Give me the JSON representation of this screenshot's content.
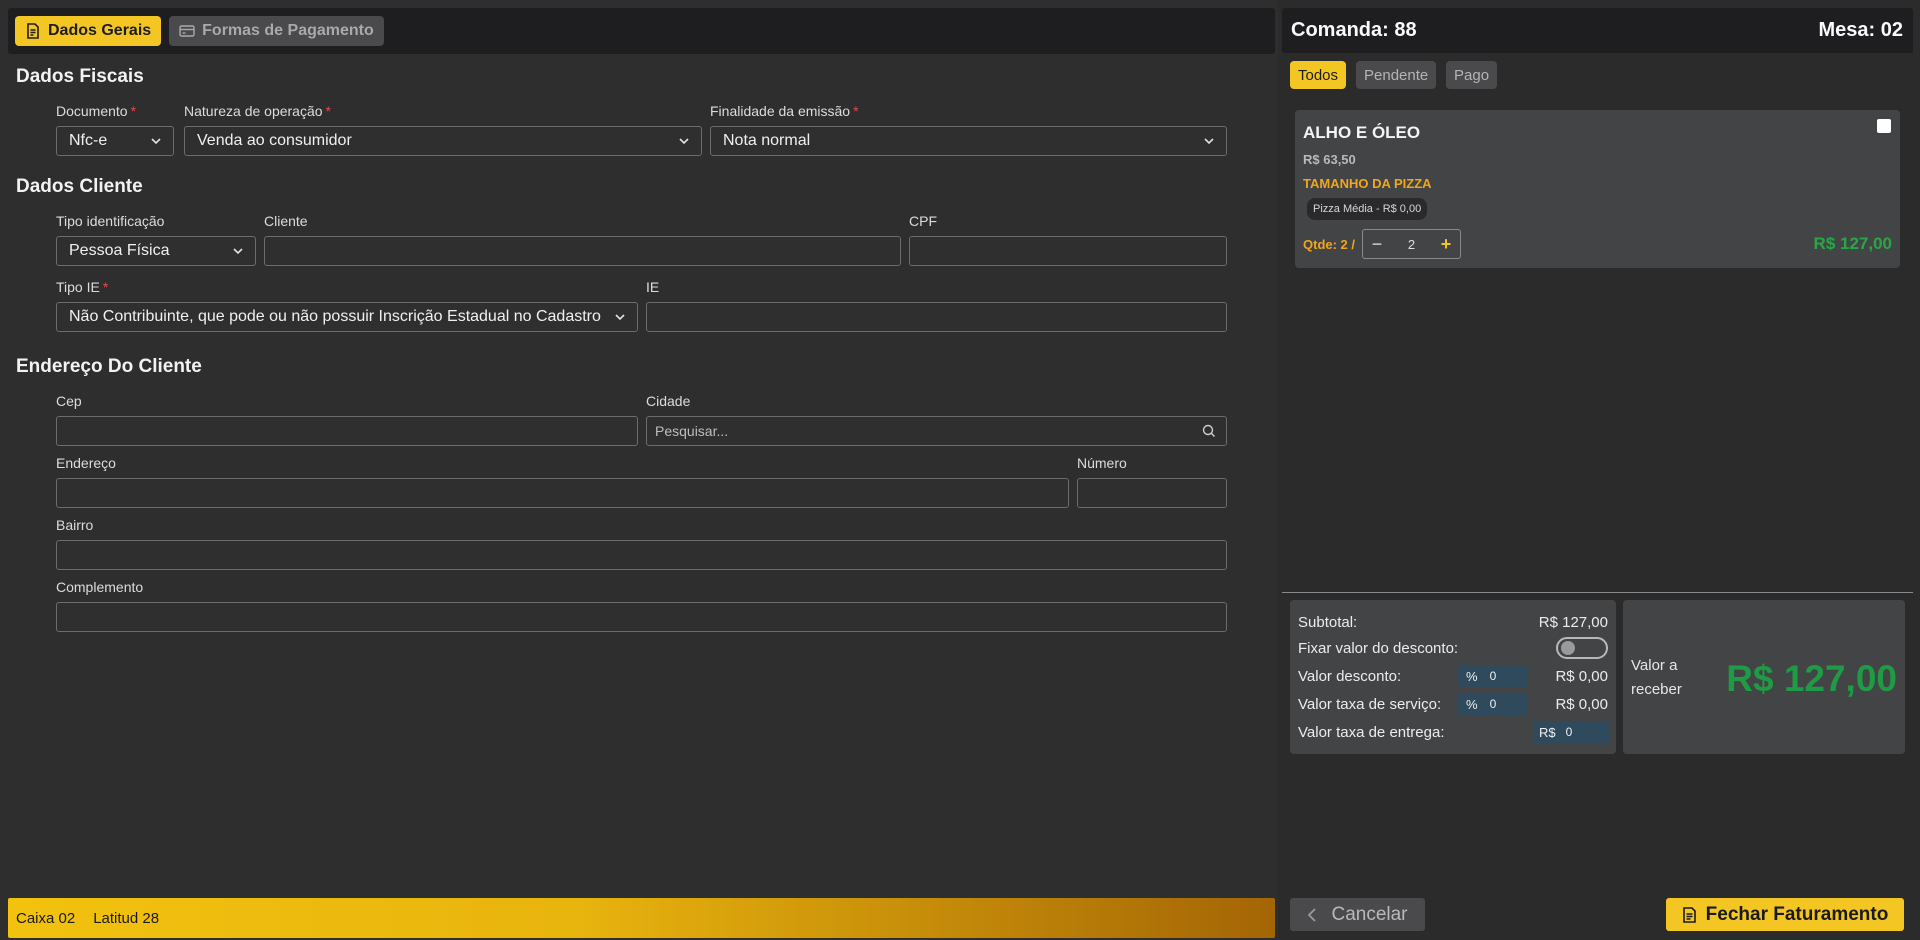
{
  "tabs": [
    {
      "label": "Dados Gerais",
      "active": true
    },
    {
      "label": "Formas de Pagamento",
      "active": false
    }
  ],
  "sections": {
    "fiscal": "Dados Fiscais",
    "client": "Dados Cliente",
    "address": "Endereço Do Cliente"
  },
  "fiscal": {
    "documento_label": "Documento",
    "documento_value": "Nfc-e",
    "natureza_label": "Natureza de operação",
    "natureza_value": "Venda ao consumidor",
    "finalidade_label": "Finalidade da emissão",
    "finalidade_value": "Nota normal"
  },
  "client": {
    "tipo_id_label": "Tipo identificação",
    "tipo_id_value": "Pessoa Física",
    "cliente_label": "Cliente",
    "cliente_value": "",
    "cpf_label": "CPF",
    "cpf_value": "",
    "tipo_ie_label": "Tipo IE",
    "tipo_ie_value": "Não Contribuinte, que pode ou não possuir Inscrição Estadual no Cadastro de Contribuintes do ICMS",
    "ie_label": "IE",
    "ie_value": ""
  },
  "address": {
    "cep_label": "Cep",
    "cep_value": "",
    "cidade_label": "Cidade",
    "cidade_placeholder": "Pesquisar...",
    "endereco_label": "Endereço",
    "endereco_value": "",
    "numero_label": "Número",
    "numero_value": "",
    "bairro_label": "Bairro",
    "bairro_value": "",
    "complemento_label": "Complemento",
    "complemento_value": ""
  },
  "required_mark": "*",
  "status": {
    "caixa": "Caixa 02",
    "latitud": "Latitud 28",
    "gradient_start": "#f2c20f",
    "gradient_end": "#a46505"
  },
  "order": {
    "comanda": "Comanda: 88",
    "mesa": "Mesa: 02"
  },
  "filters": [
    {
      "label": "Todos",
      "active": true
    },
    {
      "label": "Pendente",
      "active": false
    },
    {
      "label": "Pago",
      "active": false
    }
  ],
  "items": [
    {
      "name": "ALHO E ÓLEO",
      "unit_price": "R$ 63,50",
      "option_group": "TAMANHO DA PIZZA",
      "option": "Pizza Média - R$ 0,00",
      "qty_label": "Qtde: 2 /",
      "qty": "2",
      "total": "R$ 127,00",
      "checked": false
    }
  ],
  "summary": {
    "subtotal_label": "Subtotal:",
    "subtotal_value": "R$ 127,00",
    "fixar_label": "Fixar valor do desconto:",
    "fixar_on": false,
    "desconto_label": "Valor desconto:",
    "desconto_unit": "%",
    "desconto_input": "0",
    "desconto_value": "R$ 0,00",
    "taxa_servico_label": "Valor taxa de serviço:",
    "taxa_servico_unit": "%",
    "taxa_servico_input": "0",
    "taxa_servico_value": "R$ 0,00",
    "taxa_entrega_label": "Valor taxa de entrega:",
    "taxa_entrega_unit": "R$",
    "taxa_entrega_input": "0"
  },
  "receive": {
    "label": "Valor a receber",
    "value": "R$ 127,00"
  },
  "actions": {
    "cancel": "Cancelar",
    "close": "Fechar Faturamento"
  },
  "colors": {
    "accent": "#f3c623",
    "success": "#28a745",
    "warning": "#f0a61e",
    "required": "#e5484d"
  }
}
